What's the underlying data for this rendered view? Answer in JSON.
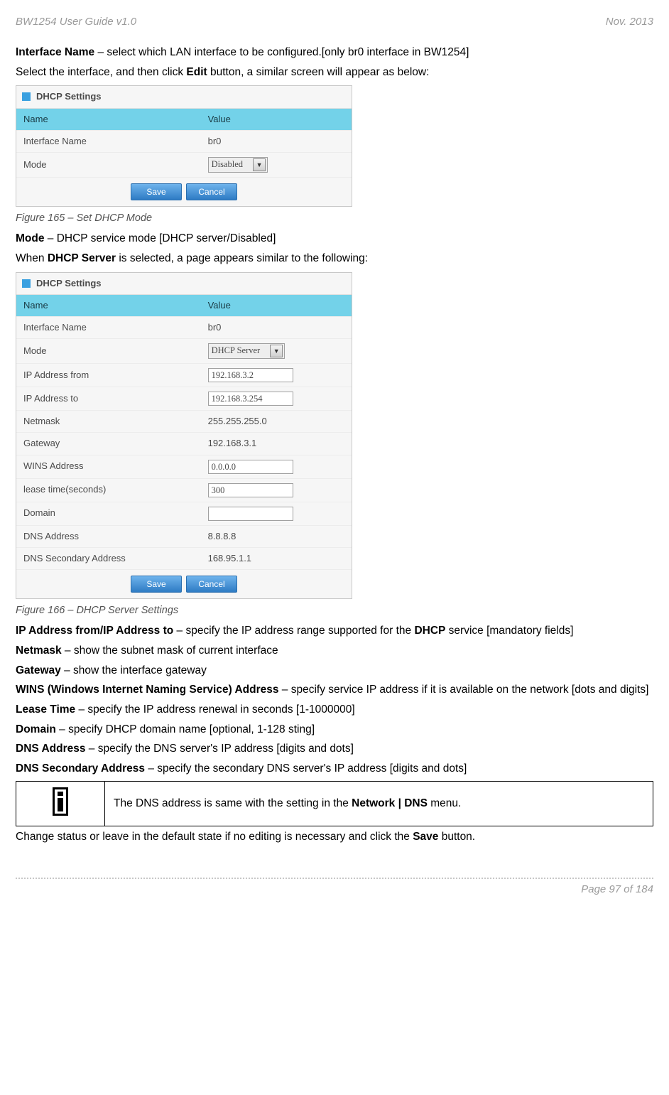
{
  "header": {
    "left": "BW1254 User Guide v1.0",
    "right": "Nov.  2013"
  },
  "p1": {
    "b": "Interface Name",
    "rest": " – select which LAN interface to be configured.[only br0 interface in BW1254]"
  },
  "p2a": "Select the interface, and then click ",
  "p2b": "Edit",
  "p2c": " button, a similar screen will appear as below:",
  "fig165": {
    "title": "DHCP Settings",
    "head_l": "Name",
    "head_r": "Value",
    "rows": [
      {
        "l": "Interface Name",
        "type": "text",
        "r": "br0"
      },
      {
        "l": "Mode",
        "type": "select",
        "r": "Disabled"
      }
    ],
    "save": "Save",
    "cancel": "Cancel",
    "caption": "Figure 165 – Set DHCP Mode"
  },
  "p3": {
    "b": "Mode",
    "rest": " – DHCP service mode [DHCP server/Disabled]"
  },
  "p4a": "When ",
  "p4b": "DHCP Server",
  "p4c": " is selected, a page appears similar to the following:",
  "fig166": {
    "title": "DHCP Settings",
    "head_l": "Name",
    "head_r": "Value",
    "rows": [
      {
        "l": "Interface Name",
        "type": "text",
        "r": "br0"
      },
      {
        "l": "Mode",
        "type": "select",
        "r": "DHCP Server"
      },
      {
        "l": "IP Address from",
        "type": "input",
        "r": "192.168.3.2"
      },
      {
        "l": "IP Address to",
        "type": "input",
        "r": "192.168.3.254"
      },
      {
        "l": "Netmask",
        "type": "text",
        "r": "255.255.255.0"
      },
      {
        "l": "Gateway",
        "type": "text",
        "r": "192.168.3.1"
      },
      {
        "l": "WINS Address",
        "type": "input",
        "r": "0.0.0.0"
      },
      {
        "l": "lease time(seconds)",
        "type": "input",
        "r": "300"
      },
      {
        "l": "Domain",
        "type": "input",
        "r": ""
      },
      {
        "l": "DNS Address",
        "type": "text",
        "r": "8.8.8.8"
      },
      {
        "l": "DNS Secondary Address",
        "type": "text",
        "r": "168.95.1.1"
      }
    ],
    "save": "Save",
    "cancel": "Cancel",
    "caption": "Figure 166 – DHCP Server Settings"
  },
  "p5": {
    "b": "IP Address from/IP Address to",
    "rest": " – specify the IP address range supported for the ",
    "b2": "DHCP",
    "rest2": " service [mandatory fields]"
  },
  "p6": {
    "b": "Netmask",
    "rest": " – show the subnet mask of current interface"
  },
  "p7": {
    "b": "Gateway",
    "rest": " – show the interface gateway"
  },
  "p8": {
    "b": "WINS (Windows Internet Naming Service) Address",
    "rest": " – specify service IP address if it is available on the network [dots and digits]"
  },
  "p9": {
    "b": "Lease Time",
    "rest": " – specify the IP address renewal in seconds [1-1000000]"
  },
  "p10": {
    "b": "Domain",
    "rest": " – specify DHCP domain name [optional, 1-128 sting]"
  },
  "p11": {
    "b": "DNS Address",
    "rest": " – specify the DNS server's IP address [digits and dots]"
  },
  "p12": {
    "b": "DNS Secondary Address",
    "rest": " – specify the secondary DNS server's IP address [digits and dots]"
  },
  "info": {
    "a": "The DNS address is same with the setting in the ",
    "b": "Network | DNS",
    "c": " menu."
  },
  "p13a": "Change status or leave in the default state if no editing is necessary and click the ",
  "p13b": "Save",
  "p13c": " button.",
  "footer": "Page 97 of 184"
}
